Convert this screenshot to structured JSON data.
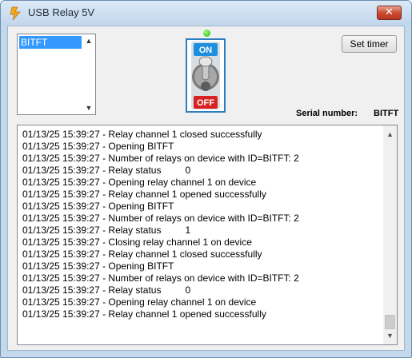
{
  "window": {
    "title": "USB Relay 5V",
    "close_glyph": "✕"
  },
  "devices": {
    "items": [
      "BITFT"
    ],
    "selected": "BITFT"
  },
  "toggle": {
    "on_label": "ON",
    "off_label": "OFF",
    "state": "off",
    "led_color": "#22b014"
  },
  "buttons": {
    "set_timer": "Set timer"
  },
  "serial": {
    "label": "Serial number:",
    "value": "BITFT"
  },
  "log": {
    "lines": [
      "01/13/25 15:39:27 - Relay channel 1 closed successfully",
      "01/13/25 15:39:27 - Opening BITFT",
      "01/13/25 15:39:27 - Number of relays on device with ID=BITFT: 2",
      "01/13/25 15:39:27 - Relay status         0",
      "01/13/25 15:39:27 - Opening relay channel 1 on device",
      "01/13/25 15:39:27 - Relay channel 1 opened successfully",
      "01/13/25 15:39:27 - Opening BITFT",
      "01/13/25 15:39:27 - Number of relays on device with ID=BITFT: 2",
      "01/13/25 15:39:27 - Relay status         1",
      "01/13/25 15:39:27 - Closing relay channel 1 on device",
      "01/13/25 15:39:27 - Relay channel 1 closed successfully",
      "01/13/25 15:39:27 - Opening BITFT",
      "01/13/25 15:39:27 - Number of relays on device with ID=BITFT: 2",
      "01/13/25 15:39:27 - Relay status         0",
      "01/13/25 15:39:27 - Opening relay channel 1 on device",
      "01/13/25 15:39:27 - Relay channel 1 opened successfully"
    ]
  },
  "icons": {
    "app": "lightning-bolt-icon",
    "scroll_up": "▲",
    "scroll_down": "▼"
  }
}
